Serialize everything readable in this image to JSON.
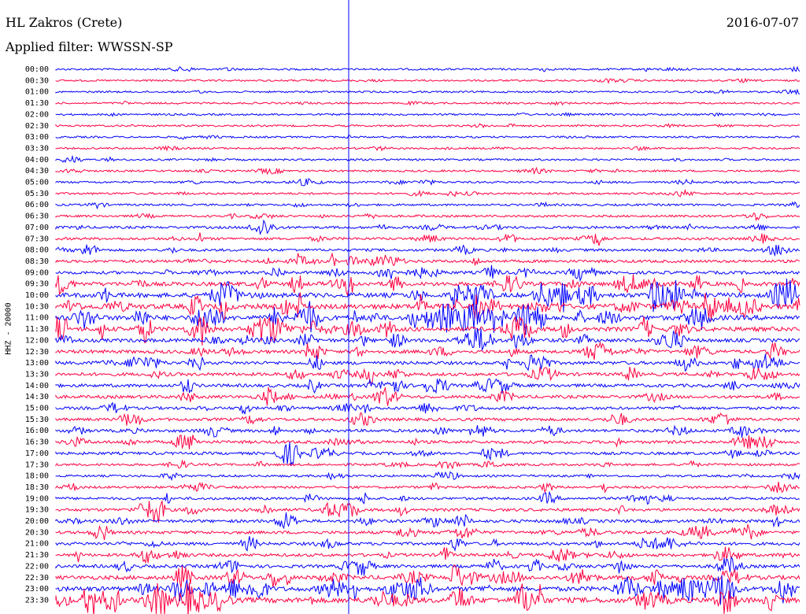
{
  "header": {
    "station": "HL Zakros (Crete)",
    "date": "2016-07-07",
    "filter": "Applied filter: WWSSN-SP"
  },
  "chart_data": {
    "type": "line",
    "title": "HL Zakros (Crete)",
    "subtitle": "Applied filter: WWSSN-SP",
    "ylabel": "HHZ - 20000",
    "xlabel": "",
    "row_labels": [
      "00:00",
      "00:30",
      "01:00",
      "01:30",
      "02:00",
      "02:30",
      "03:00",
      "03:30",
      "04:00",
      "04:30",
      "05:00",
      "05:30",
      "06:00",
      "06:30",
      "07:00",
      "07:30",
      "08:00",
      "08:30",
      "09:00",
      "09:30",
      "10:00",
      "10:30",
      "11:00",
      "11:30",
      "12:00",
      "12:30",
      "13:00",
      "13:30",
      "14:00",
      "14:30",
      "15:00",
      "15:30",
      "16:00",
      "16:30",
      "17:00",
      "17:30",
      "18:00",
      "18:30",
      "19:00",
      "19:30",
      "20:00",
      "20:30",
      "21:00",
      "21:30",
      "22:00",
      "22:30",
      "23:00",
      "23:30"
    ],
    "row_activity": [
      0.25,
      0.2,
      0.2,
      0.2,
      0.22,
      0.2,
      0.2,
      0.18,
      0.25,
      0.25,
      0.3,
      0.3,
      0.3,
      0.35,
      0.55,
      0.6,
      0.6,
      0.7,
      0.8,
      1.3,
      1.6,
      1.8,
      1.7,
      1.5,
      1.1,
      1.0,
      0.95,
      0.9,
      0.9,
      0.85,
      0.7,
      0.75,
      0.75,
      0.8,
      0.7,
      0.45,
      0.4,
      0.5,
      0.6,
      0.75,
      0.8,
      0.8,
      0.8,
      0.8,
      0.9,
      1.3,
      1.6,
      1.9
    ],
    "series_colors": [
      "#0000ff",
      "#ff0040"
    ],
    "marker_fraction": 0.3,
    "grid": false
  }
}
